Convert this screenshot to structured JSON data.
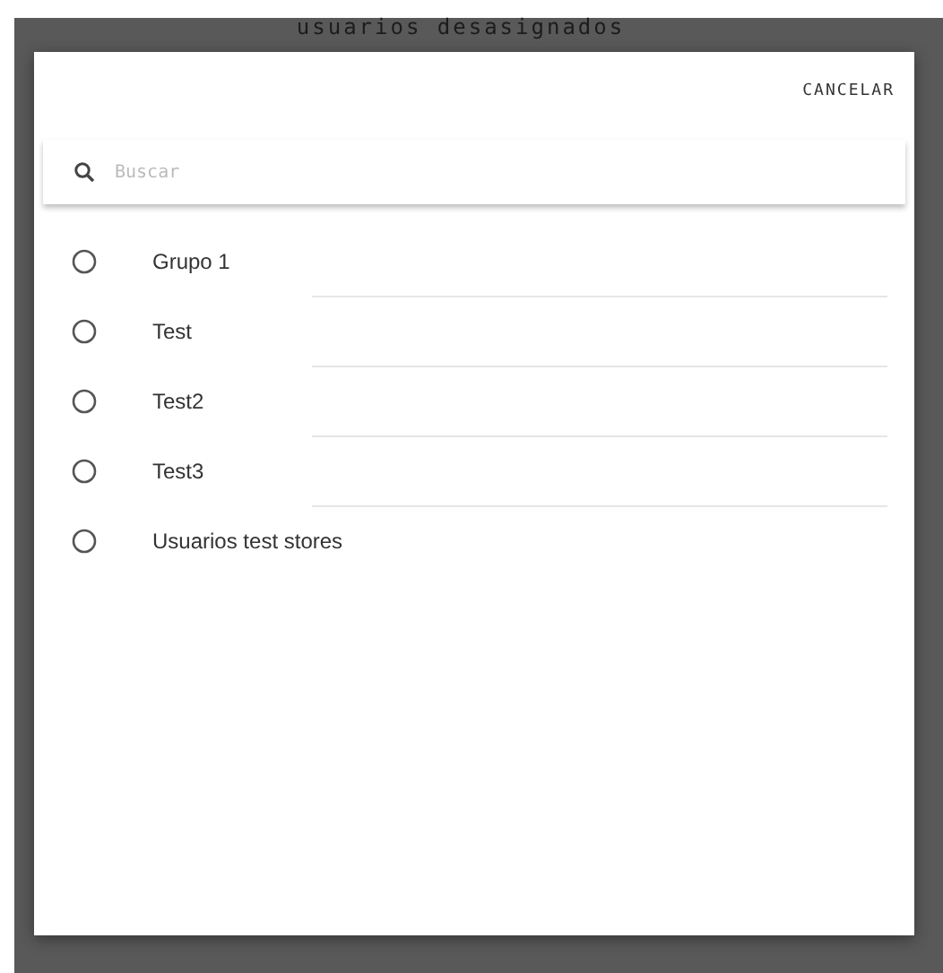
{
  "background": {
    "title": "usuarios desasignados"
  },
  "dialog": {
    "cancel_button": "CANCELAR",
    "search": {
      "placeholder": "Buscar"
    },
    "options": [
      {
        "label": "Grupo 1",
        "selected": false
      },
      {
        "label": "Test",
        "selected": false
      },
      {
        "label": "Test2",
        "selected": false
      },
      {
        "label": "Test3",
        "selected": false
      },
      {
        "label": "Usuarios test stores",
        "selected": false
      }
    ]
  }
}
